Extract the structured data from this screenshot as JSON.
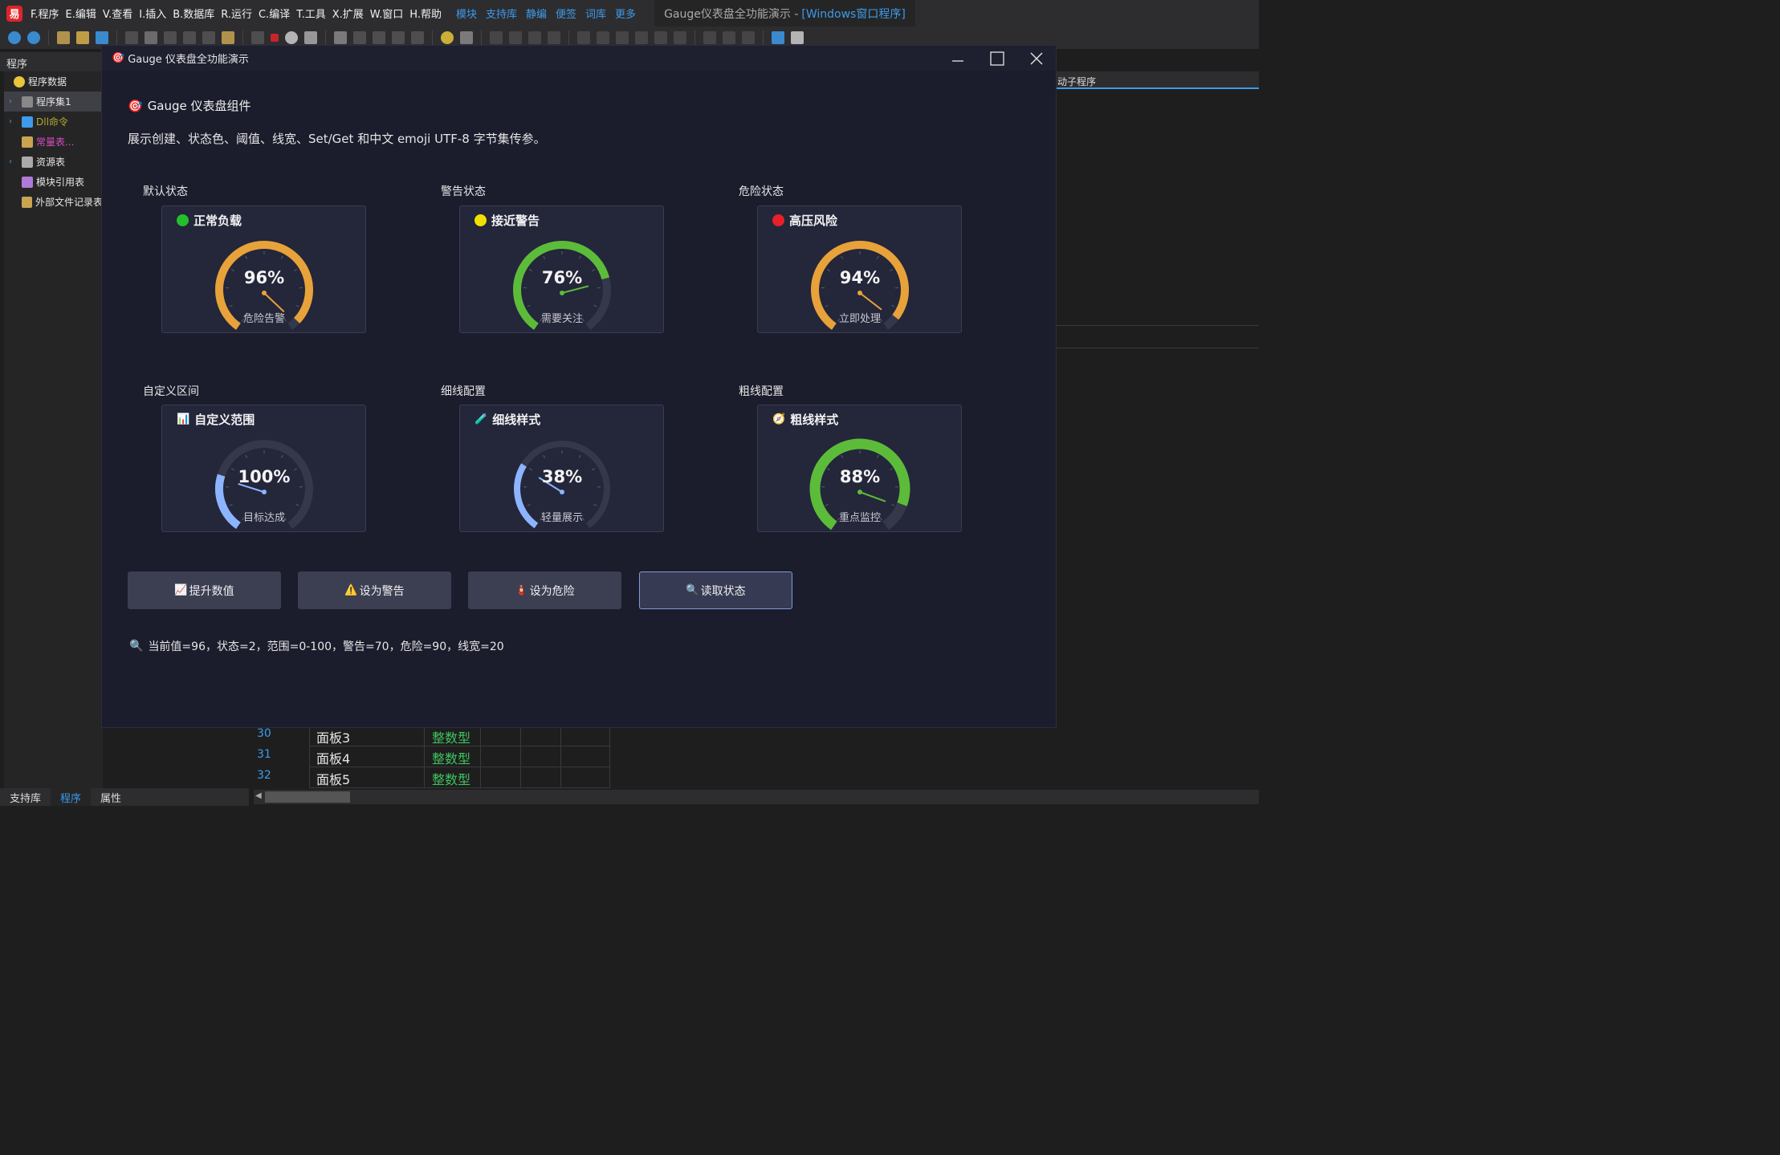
{
  "ide": {
    "menu": [
      "F.程序",
      "E.编辑",
      "V.查看",
      "I.插入",
      "B.数据库",
      "R.运行",
      "C.编译",
      "T.工具",
      "X.扩展",
      "W.窗口",
      "H.帮助"
    ],
    "menu_links": [
      "模块",
      "支持库",
      "静编",
      "便签",
      "词库",
      "更多"
    ],
    "title_main": "Gauge仪表盘全功能演示 -",
    "title_hl": "[Windows窗口程序]",
    "left_header": "程序",
    "tree": [
      {
        "label": "程序数据",
        "style": "normal"
      },
      {
        "label": "程序集1",
        "style": "normal"
      },
      {
        "label": "Dll命令",
        "style": "olive"
      },
      {
        "label": "常量表...",
        "style": "pink"
      },
      {
        "label": "资源表",
        "style": "normal"
      },
      {
        "label": "模块引用表",
        "style": "normal"
      },
      {
        "label": "外部文件记录表",
        "style": "normal"
      }
    ],
    "bottom_tabs": [
      "支持库",
      "程序",
      "属性"
    ],
    "right_strip": "动子程序",
    "code_rows": [
      {
        "ln": "30",
        "name": "面板3",
        "type": "整数型"
      },
      {
        "ln": "31",
        "name": "面板4",
        "type": "整数型"
      },
      {
        "ln": "32",
        "name": "面板5",
        "type": "整数型"
      }
    ]
  },
  "dialog": {
    "title_icon": "🎯",
    "title": "Gauge 仪表盘全功能演示",
    "heading_icon": "🎯",
    "heading": "Gauge 仪表盘组件",
    "subtitle": "展示创建、状态色、阈值、线宽、Set/Get 和中文 emoji UTF-8 字节集传参。",
    "gauges": [
      {
        "section": "默认状态",
        "title": "正常负载",
        "icon": "dot",
        "icon_color": "#22c02a",
        "value": 96,
        "value_text": "96%",
        "label": "危险告警",
        "arc_color": "#e8a23a",
        "min": 0,
        "max": 100
      },
      {
        "section": "警告状态",
        "title": "接近警告",
        "icon": "dot",
        "icon_color": "#f4e000",
        "value": 76,
        "value_text": "76%",
        "label": "需要关注",
        "arc_color": "#5cbc3a",
        "min": 0,
        "max": 100
      },
      {
        "section": "危险状态",
        "title": "高压风险",
        "icon": "dot",
        "icon_color": "#e8202a",
        "value": 94,
        "value_text": "94%",
        "label": "立即处理",
        "arc_color": "#e8a23a",
        "min": 0,
        "max": 100
      },
      {
        "section": "自定义区间",
        "title": "自定义范围",
        "icon": "📊",
        "value": 25,
        "value_text": "100%",
        "label": "目标达成",
        "arc_color": "#8cb4ff",
        "min": 0,
        "max": 100
      },
      {
        "section": "细线配置",
        "title": "细线样式",
        "icon": "🧪",
        "value": 30,
        "value_text": "38%",
        "label": "轻量展示",
        "arc_color": "#8cb4ff",
        "min": 0,
        "max": 100
      },
      {
        "section": "粗线配置",
        "title": "粗线样式",
        "icon": "🧭",
        "value": 88,
        "value_text": "88%",
        "label": "重点监控",
        "arc_color": "#5cbc3a",
        "min": 0,
        "max": 100
      }
    ],
    "buttons": [
      {
        "icon": "📈",
        "label": "提升数值"
      },
      {
        "icon": "⚠️",
        "label": "设为警告"
      },
      {
        "icon": "🧯",
        "label": "设为危险"
      },
      {
        "icon": "🔍",
        "label": "读取状态"
      }
    ],
    "status_icon": "🔍",
    "status": "当前值=96，状态=2，范围=0-100，警告=70，危险=90，线宽=20"
  }
}
